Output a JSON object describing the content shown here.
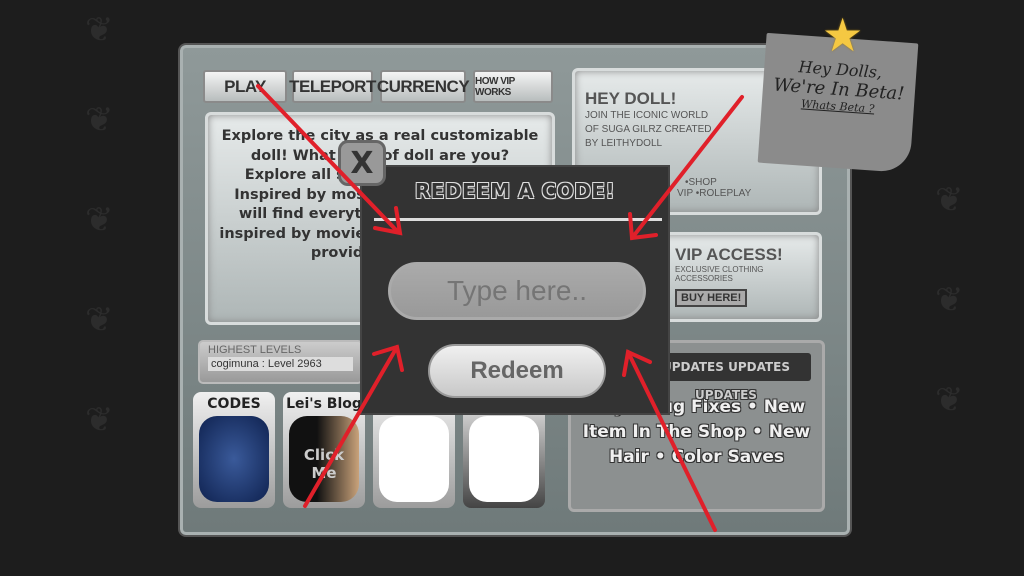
{
  "tabs": [
    "PLAY",
    "TELEPORT",
    "CURRENCY",
    "HOW VIP WORKS"
  ],
  "description": "Explore the city as a real customizable doll! What type of doll are you? Explore all styles and aesthetics. Inspired by most famous Bratz, you will find everything we have being inspired by moviestarplanet, we aim to provide a unique",
  "highest_levels": {
    "title": "HIGHEST LEVELS",
    "entry": "cogimuna : Level 2963"
  },
  "cards": [
    {
      "label": "CODES"
    },
    {
      "label": "Lei's Blog",
      "overlay": "Click Me"
    },
    {
      "label": ""
    },
    {
      "label": ""
    }
  ],
  "hey_doll": {
    "title": "HEY DOLL!",
    "lines": [
      "JOIN THE ICONIC WORLD",
      "OF SUGA GILRZ CREATED",
      "BY LEITHYDOLL"
    ],
    "features": [
      "•SHOP",
      "VIP •ROLEPLAY"
    ]
  },
  "vip": {
    "title": "VIP ACCESS!",
    "subtitle": "EXCLUSIVE CLOTHING ACCESSORIES",
    "button": "BUY HERE!"
  },
  "updates": {
    "banner": "UPDATES UPDATES UPDATES",
    "items": "Major Bug Fixes • New Item In The Shop • New Hair • Color Saves"
  },
  "note": {
    "line1": "Hey Dolls,",
    "line2": "We're In Beta!",
    "link": "Whats Beta ?"
  },
  "modal": {
    "title": "REDEEM A CODE!",
    "placeholder": "Type here..",
    "button": "Redeem",
    "close": "X"
  },
  "colors": {
    "arrow": "#e0202a",
    "modal": "#333333",
    "star": "#f5c842"
  }
}
